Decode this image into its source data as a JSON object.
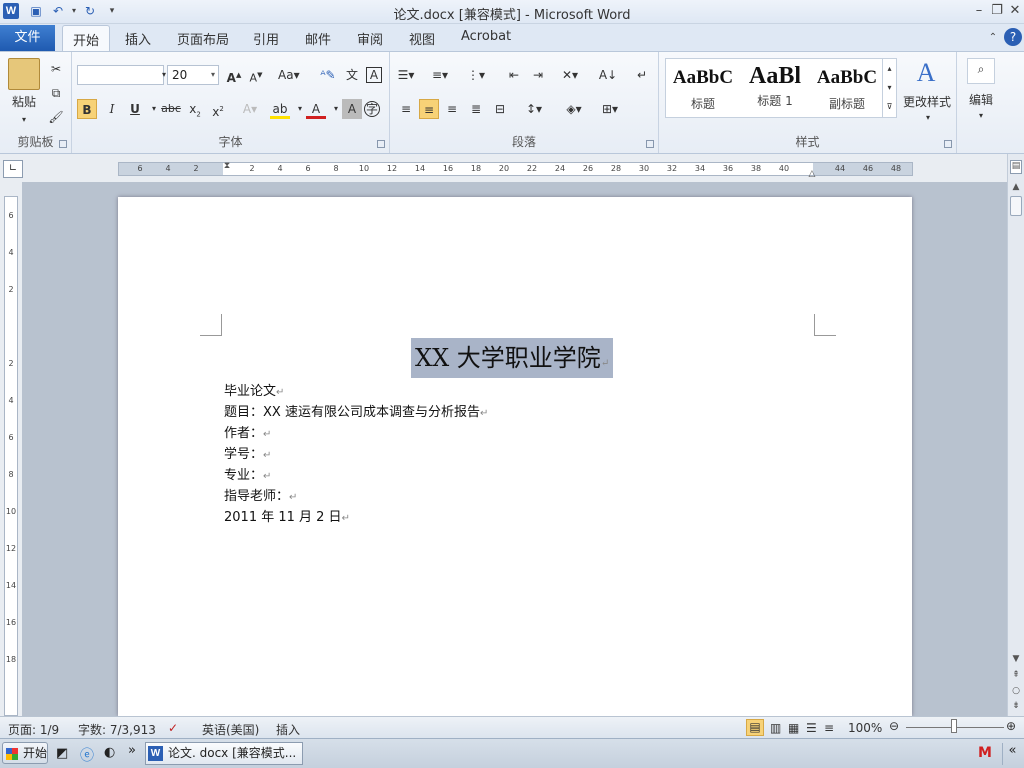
{
  "window": {
    "title": "论文.docx [兼容模式] - Microsoft Word",
    "logo": "W"
  },
  "tabs": {
    "file": "文件",
    "items": [
      "开始",
      "插入",
      "页面布局",
      "引用",
      "邮件",
      "审阅",
      "视图",
      "Acrobat"
    ],
    "active": "开始"
  },
  "ribbon": {
    "clipboard": {
      "label": "剪贴板",
      "paste": "粘贴"
    },
    "font": {
      "label": "字体",
      "font_name": "",
      "font_size": "20"
    },
    "paragraph": {
      "label": "段落"
    },
    "styles": {
      "label": "样式",
      "items": [
        {
          "preview": "AaBbC",
          "name": "标题"
        },
        {
          "preview": "AaBl",
          "name": "标题 1"
        },
        {
          "preview": "AaBbC",
          "name": "副标题"
        }
      ],
      "change": "更改样式"
    },
    "editing": {
      "label": "编辑"
    }
  },
  "ruler": {
    "ticks": [
      "6",
      "4",
      "2",
      "",
      "2",
      "4",
      "6",
      "8",
      "10",
      "12",
      "14",
      "16",
      "18",
      "20",
      "22",
      "24",
      "26",
      "28",
      "30",
      "32",
      "34",
      "36",
      "38",
      "40",
      "",
      "44",
      "46",
      "48"
    ],
    "vticks": [
      "6",
      "4",
      "2",
      "",
      "2",
      "4",
      "6",
      "8",
      "10",
      "12",
      "14",
      "16",
      "18"
    ]
  },
  "document": {
    "title": "XX 大学职业学院",
    "lines": [
      "毕业论文",
      "题目：XX 速运有限公司成本调查与分析报告",
      "作者：",
      "学号：",
      "专业：",
      "指导老师：",
      "2011 年 11 月 2 日"
    ],
    "para_mark": "↵"
  },
  "status": {
    "page": "页面: 1/9",
    "words": "字数: 7/3,913",
    "language": "英语(美国)",
    "mode": "插入",
    "zoom": "100%"
  },
  "taskbar": {
    "start": "开始",
    "item": "论文. docx [兼容模式..."
  },
  "colors": {
    "accent": "#2b5fb4",
    "selection": "#a9b4c8"
  }
}
